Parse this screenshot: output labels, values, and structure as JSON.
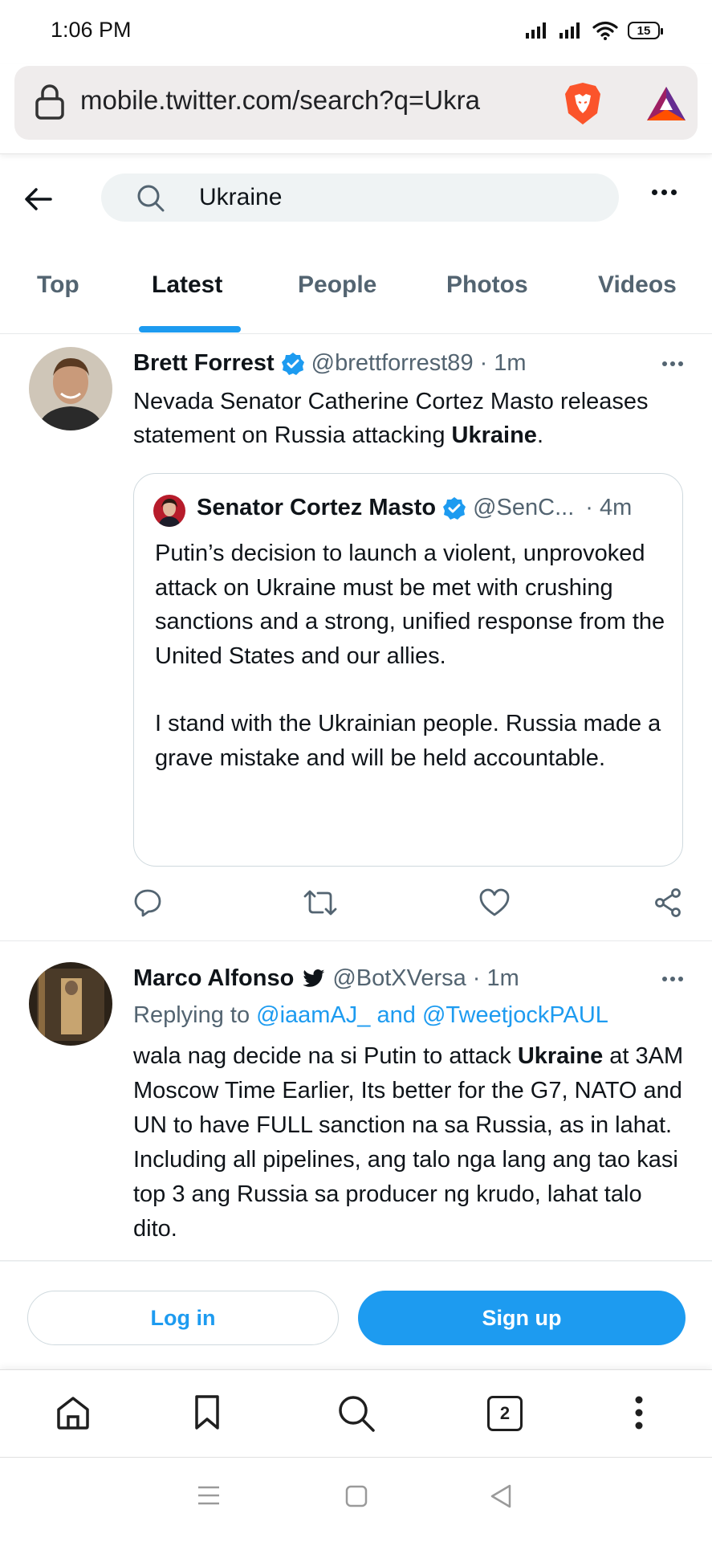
{
  "status_bar": {
    "time": "1:06 PM",
    "battery": "15"
  },
  "browser": {
    "url": "mobile.twitter.com/search?q=Ukra",
    "tab_count": "2",
    "bottom_icons": [
      "home-icon",
      "bookmark-icon",
      "search-icon",
      "tabs-icon",
      "menu-icon"
    ]
  },
  "search": {
    "query": "Ukraine"
  },
  "tabs": [
    {
      "label": "Top"
    },
    {
      "label": "Latest"
    },
    {
      "label": "People"
    },
    {
      "label": "Photos"
    },
    {
      "label": "Videos"
    }
  ],
  "active_tab": "Latest",
  "tweets": [
    {
      "name": "Brett Forrest",
      "handle": "@brettforrest89",
      "time": "· 1m",
      "body_pre": "Nevada Senator Catherine Cortez Masto releases statement on Russia attacking ",
      "body_bold": "Ukraine",
      "body_post": ".",
      "quote": {
        "name": "Senator Cortez Masto",
        "handle": "@SenC...",
        "time": "· 4m",
        "para1": "Putin’s decision to launch a violent, unprovoked attack on Ukraine must be met with crushing sanctions and a strong, unified response from the United States and our allies.",
        "para2": "I stand with the Ukrainian people. Russia made a grave mistake and will be held accountable."
      }
    },
    {
      "name": "Marco Alfonso",
      "handle": "@BotXVersa",
      "time": "· 1m",
      "replying_label": "Replying to",
      "reply_mention_1": "@iaamAJ_",
      "reply_and": "and",
      "reply_mention_2": "@TweetjockPAUL",
      "body_pre": "wala nag decide na si Putin to attack ",
      "body_bold": "Ukraine",
      "body_post": " at 3AM Moscow Time Earlier, Its better for the G7, NATO and UN to have FULL sanction na sa Russia, as in lahat. Including all pipelines, ang talo nga lang ang tao kasi top 3 ang Russia sa producer ng krudo, lahat talo dito."
    }
  ],
  "auth": {
    "login": "Log in",
    "signup": "Sign up"
  },
  "colors": {
    "accent": "#1d9bf0",
    "text": "#0f1419",
    "muted": "#536471"
  }
}
